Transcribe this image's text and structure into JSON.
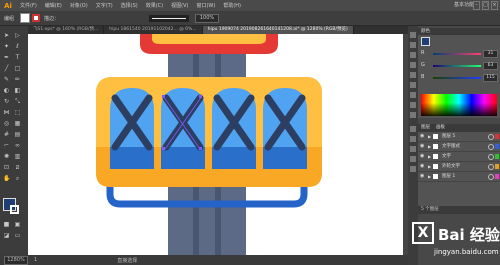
{
  "app": {
    "logo": "Ai"
  },
  "menubar": {
    "items": [
      "文件(F)",
      "编辑(E)",
      "对象(O)",
      "文字(T)",
      "选择(S)",
      "效果(C)",
      "视图(V)",
      "窗口(W)",
      "帮助(H)"
    ],
    "workspace": "基本功能"
  },
  "control": {
    "selection_label": "编组",
    "stroke_label": "描边：",
    "opacity": "100%",
    "fill_color": "#ffffff",
    "stroke_color": "#cc3333"
  },
  "tabs": [
    "飞S1.eps* @ 160% (RGB/预...",
    "hipu 1861540 20191102042... @ 6%...",
    "hipu 1909074 201908261640141208.ai* @ 1280% (RGB/预览)"
  ],
  "colors": {
    "panel_title": "颜色",
    "fill": "#1f3f73",
    "channels": [
      {
        "letter": "R",
        "value": "31"
      },
      {
        "letter": "G",
        "value": "63"
      },
      {
        "letter": "B",
        "value": "115"
      }
    ]
  },
  "layers": {
    "tabs": [
      "图层",
      "画板"
    ],
    "rows": [
      {
        "name": "图层 5",
        "color": "#e03030"
      },
      {
        "name": "文字版式",
        "color": "#3060e0"
      },
      {
        "name": "文字",
        "color": "#30c030"
      },
      {
        "name": "外轮文字",
        "color": "#e0a020"
      },
      {
        "name": "图层 1",
        "color": "#e040c0"
      }
    ],
    "footer": "5 个图层"
  },
  "status": {
    "zoom": "1280%",
    "page": "1",
    "selection": "直接选择"
  },
  "watermark": {
    "glyph": "X",
    "text": "Bai 经验",
    "url": "jingyan.baidu.com"
  },
  "illustration": {
    "pole_color": "#5d6a85",
    "pole_stripe": "#4a5670",
    "yellow": "#ffbf40",
    "orange": "#f9a825",
    "red_top": "#e53935",
    "window_light": "#4fa3f0",
    "window_dark": "#2a6fc9",
    "cross": "#2d3e63",
    "rail": "#2563c9"
  }
}
